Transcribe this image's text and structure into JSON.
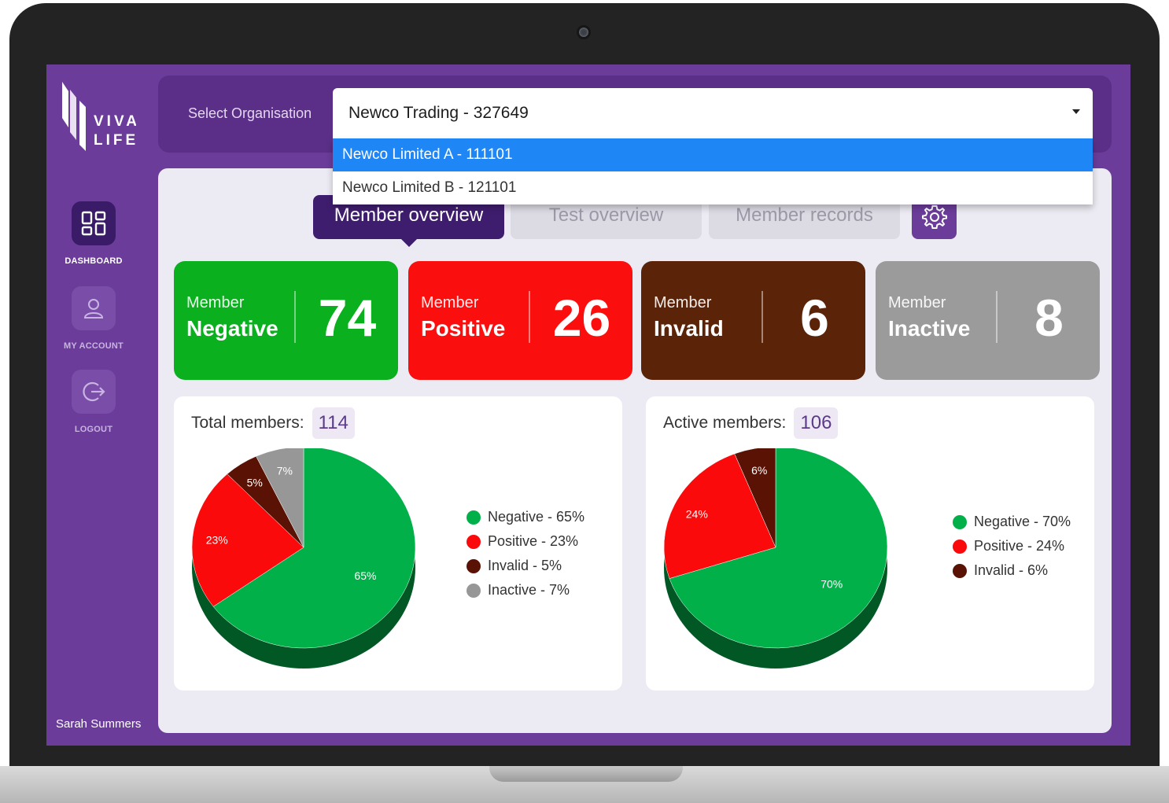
{
  "sidebar": {
    "logo_text": "VIVA LIFE",
    "items": [
      {
        "label": "DASHBOARD",
        "icon": "dashboard-icon",
        "active": true
      },
      {
        "label": "MY ACCOUNT",
        "icon": "user-icon",
        "active": false
      },
      {
        "label": "LOGOUT",
        "icon": "logout-icon",
        "active": false
      }
    ],
    "user_name": "Sarah Summers"
  },
  "org_selector": {
    "label": "Select Organisation",
    "selected": "Newco Trading - 327649",
    "options": [
      {
        "label": "Newco Limited A - 111101",
        "highlighted": true
      },
      {
        "label": "Newco Limited B - 121101",
        "highlighted": false
      }
    ]
  },
  "tabs": [
    {
      "label": "Member overview",
      "active": true
    },
    {
      "label": "Test overview",
      "active": false
    },
    {
      "label": "Member records",
      "active": false
    }
  ],
  "settings_icon": "gear-icon",
  "stats": [
    {
      "caption": "Member",
      "title": "Negative",
      "value": "74",
      "color": "#0bb01f"
    },
    {
      "caption": "Member",
      "title": "Positive",
      "value": "26",
      "color": "#fa0e0e"
    },
    {
      "caption": "Member",
      "title": "Invalid",
      "value": "6",
      "color": "#5b2408"
    },
    {
      "caption": "Member",
      "title": "Inactive",
      "value": "8",
      "color": "#9b9b9b"
    }
  ],
  "charts": {
    "total": {
      "label": "Total members:",
      "count": "114"
    },
    "active": {
      "label": "Active members:",
      "count": "106"
    }
  },
  "legends": {
    "total": [
      "Negative - 65%",
      "Positive  - 23%",
      "Invalid  -  5%",
      "Inactive  - 7%"
    ],
    "active": [
      "Negative - 70%",
      "Positive  - 24%",
      "Invalid - 6%"
    ]
  },
  "colors": {
    "negative": "#02b04a",
    "positive": "#fa0a0a",
    "invalid": "#5a1204",
    "inactive": "#979797",
    "brand_purple": "#6b3c9a",
    "tab_active": "#3f1d6e",
    "dropdown_highlight": "#1e86f5"
  },
  "chart_data": [
    {
      "type": "pie",
      "title": "Total members: 114",
      "labels": [
        "Negative",
        "Positive",
        "Invalid",
        "Inactive"
      ],
      "values": [
        65,
        23,
        5,
        7
      ],
      "value_labels": [
        "65%",
        "23%",
        "5%",
        "7%"
      ],
      "colors": [
        "#02b04a",
        "#fa0a0a",
        "#5a1204",
        "#979797"
      ],
      "legend": "right"
    },
    {
      "type": "pie",
      "title": "Active members: 106",
      "labels": [
        "Negative",
        "Positive",
        "Invalid"
      ],
      "values": [
        70,
        24,
        6
      ],
      "value_labels": [
        "70%",
        "24%",
        "6%"
      ],
      "colors": [
        "#02b04a",
        "#fa0a0a",
        "#5a1204"
      ],
      "legend": "right"
    }
  ]
}
